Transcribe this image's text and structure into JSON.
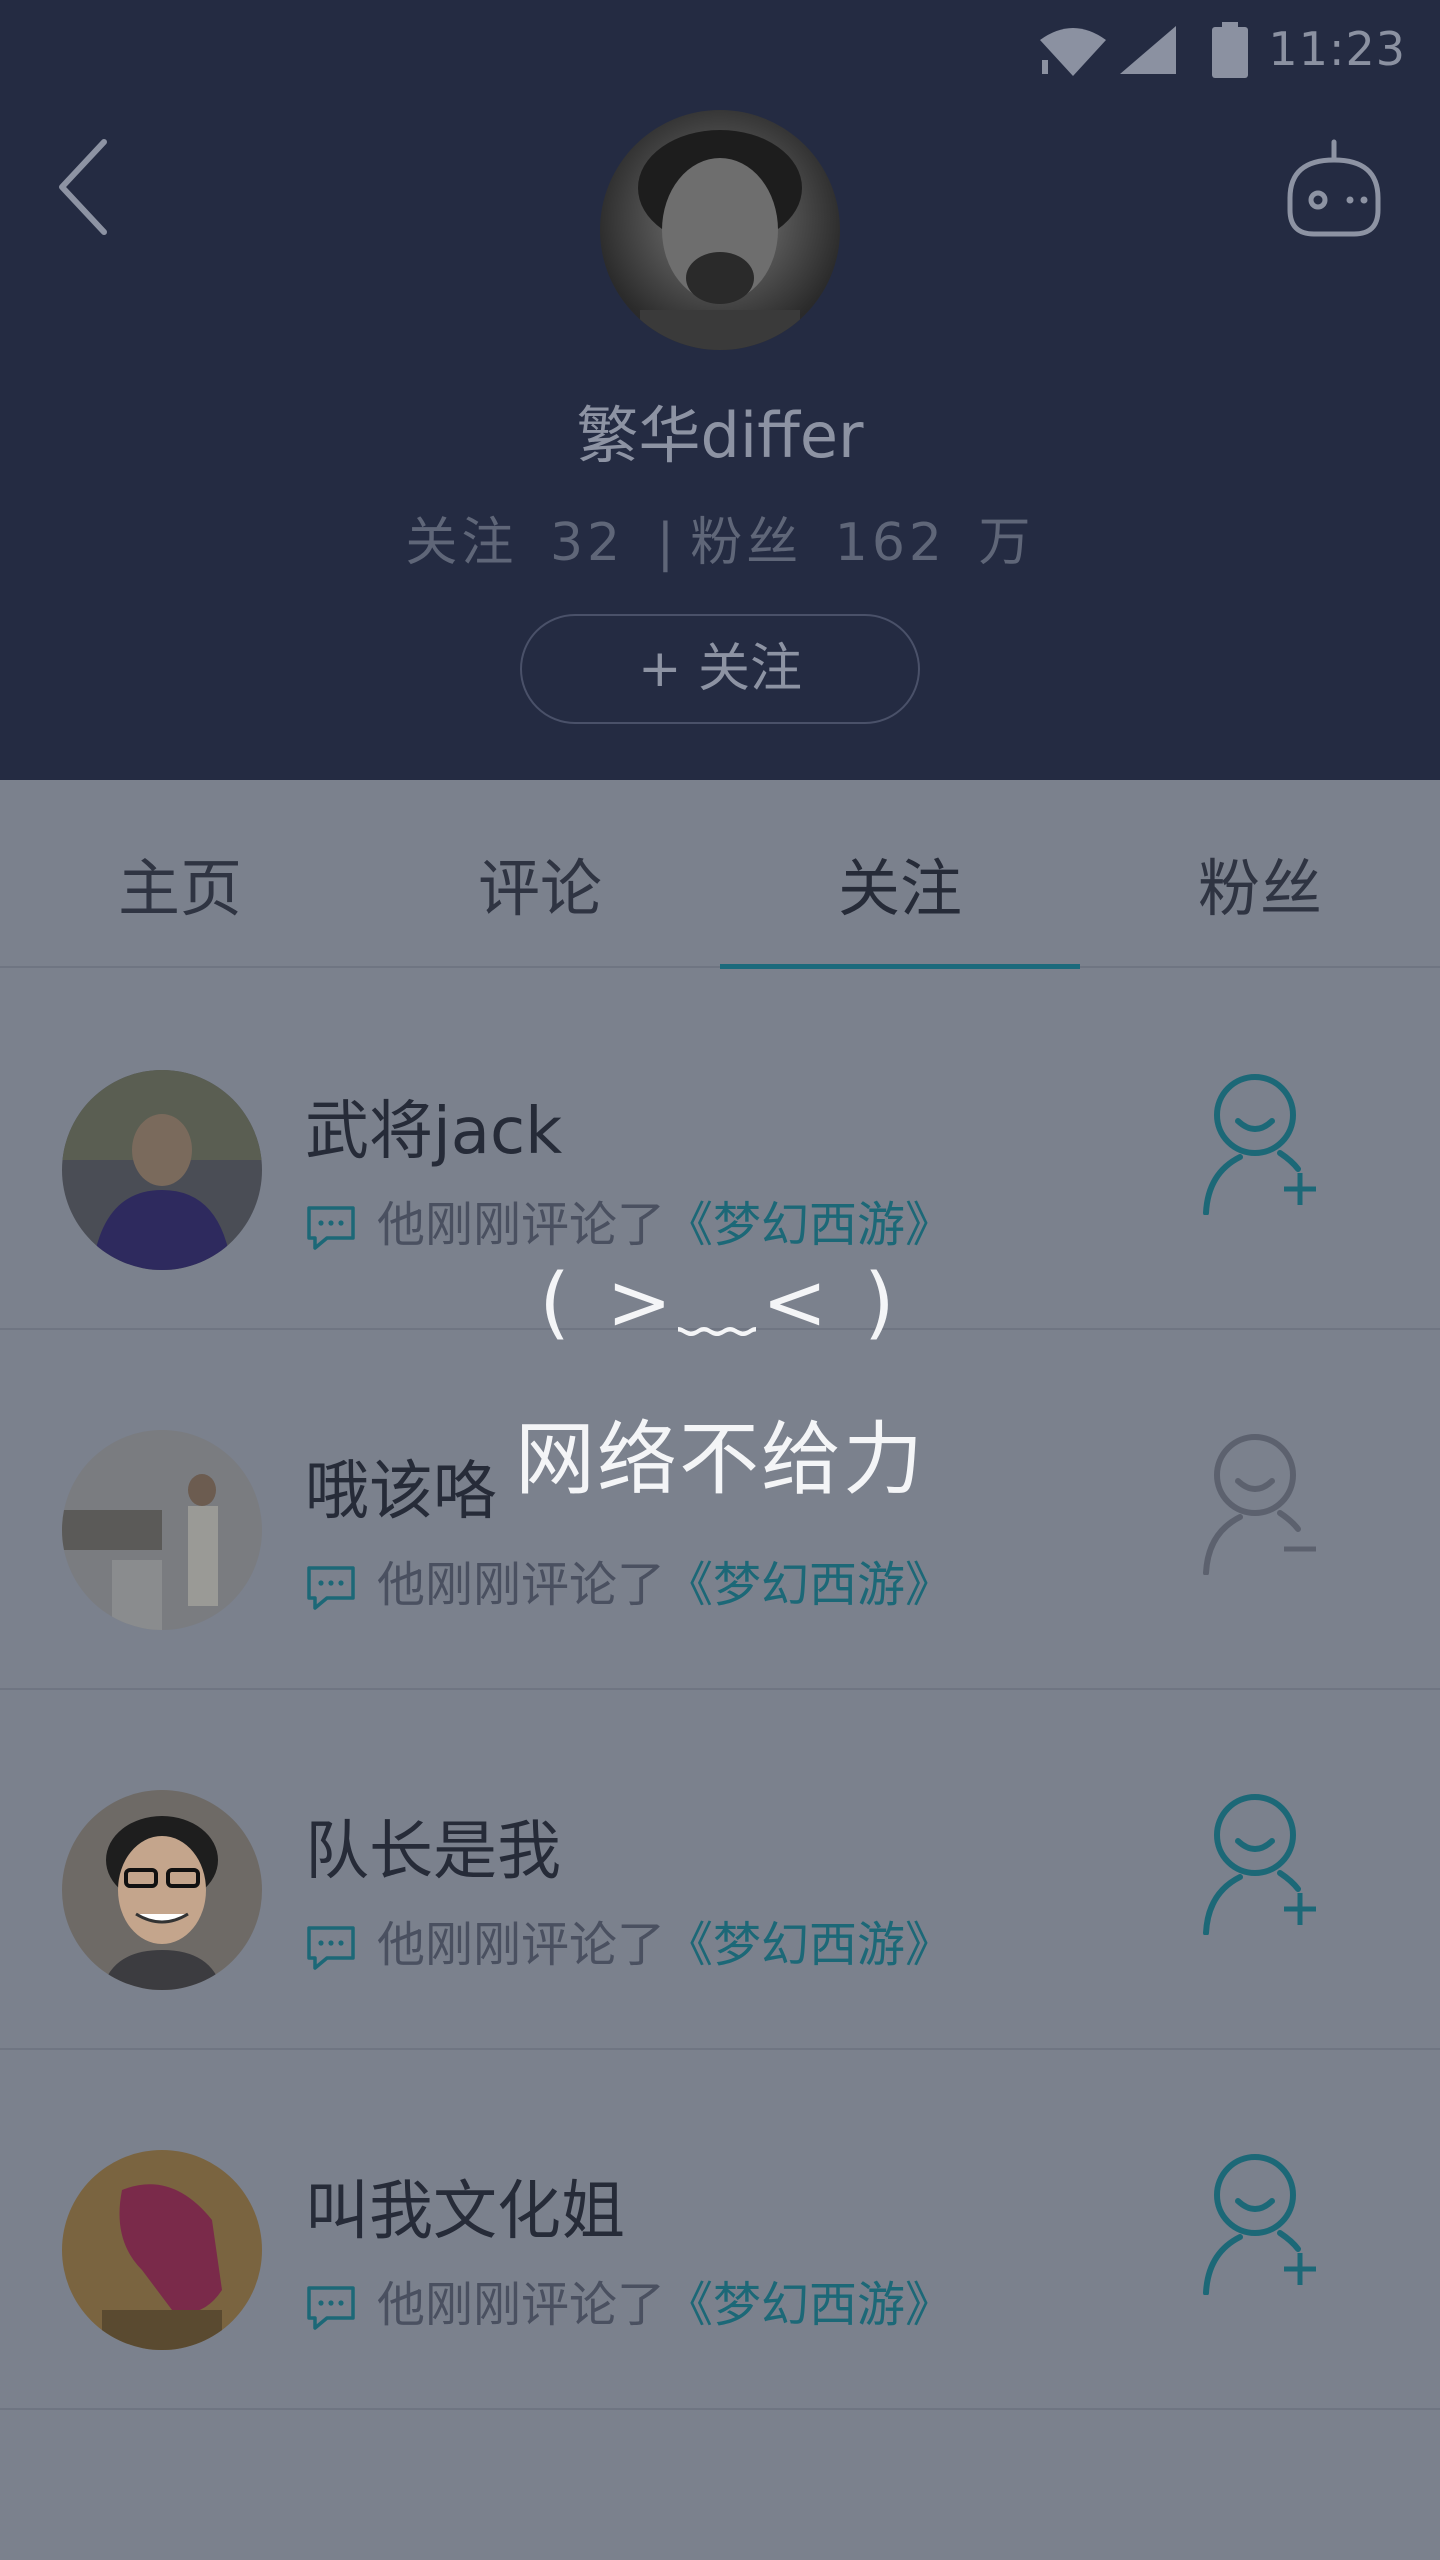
{
  "status_bar": {
    "time": "11:23"
  },
  "profile": {
    "name": "繁华differ",
    "follow_label": "关注",
    "follow_count": "32",
    "separator": "|",
    "fans_label": "粉丝",
    "fans_count": "162",
    "fans_unit": "万",
    "follow_button": "+ 关注"
  },
  "tabs": [
    {
      "label": "主页"
    },
    {
      "label": "评论"
    },
    {
      "label": "关注"
    },
    {
      "label": "粉丝"
    }
  ],
  "active_tab": "关注",
  "list": [
    {
      "name": "武将jack",
      "sub_text": "他刚刚评论了",
      "sub_link": "《梦幻西游》",
      "action": "follow-add"
    },
    {
      "name": "哦该咯",
      "sub_text": "他刚刚评论了",
      "sub_link": "《梦幻西游》",
      "action": "follow-remove"
    },
    {
      "name": "队长是我",
      "sub_text": "他刚刚评论了",
      "sub_link": "《梦幻西游》",
      "action": "follow-add"
    },
    {
      "name": "叫我文化姐",
      "sub_text": "他刚刚评论了",
      "sub_link": "《梦幻西游》",
      "action": "follow-add"
    }
  ],
  "error": {
    "face": "( >﹏< )",
    "message": "网络不给力"
  },
  "colors": {
    "header_bg": "#242b42",
    "overlay_bg": "#7b818d",
    "accent": "#1c6a7c"
  }
}
